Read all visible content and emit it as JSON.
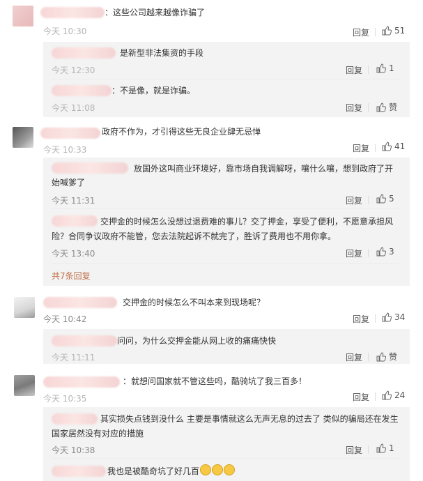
{
  "comments": [
    {
      "text": "：这些公司越来越像诈骗了",
      "time": "今天 10:30",
      "reply": "回复",
      "likes": "51"
    },
    {
      "text": "是新型非法集资的手段",
      "time": "今天 12:30",
      "reply": "回复",
      "likes": "1"
    },
    {
      "text": "：不是像，就是诈骗。",
      "time": "今天 11:08",
      "reply": "回复",
      "likes": "赞"
    },
    {
      "text": "政府不作为，才引得这些无良企业肆无忌惮",
      "time": "今天 10:33",
      "reply": "回复",
      "likes": "41"
    },
    {
      "text": "放国外这叫商业环境好，靠市场自我调解呀，嚷什么嚷，想到政府了开始喊爹了",
      "time": "今天 11:31",
      "reply": "回复",
      "likes": "5"
    },
    {
      "text": "交押金的时候怎么没想过退费难的事儿？交了押金，享受了便利，不愿意承担风险？合同争议政府不能管，您去法院起诉不就完了，胜诉了费用也不用你拿。",
      "time": "今天 13:40",
      "reply": "回复",
      "likes": "3"
    },
    {
      "more": "共7条回复"
    },
    {
      "text": "交押金的时候怎么不叫本来到现场呢？",
      "time": "今天 10:42",
      "reply": "回复",
      "likes": "34"
    },
    {
      "text": "问问，为什么交押金能从网上收的痛痛快快",
      "time": "今天 11:11",
      "reply": "回复",
      "likes": "赞"
    },
    {
      "text": "：就想问国家就不管这些吗，酷骑坑了我三百多！",
      "time": "今天 10:35",
      "reply": "回复",
      "likes": "24"
    },
    {
      "text": "其实损失点钱到没什么 主要是事情就这么无声无息的过去了 类似的骗局还在发生 国家居然没有对应的措施",
      "time": "今天 10:38",
      "reply": "回复",
      "likes": "1"
    },
    {
      "text": "我也是被酷奇坑了好几百"
    }
  ]
}
